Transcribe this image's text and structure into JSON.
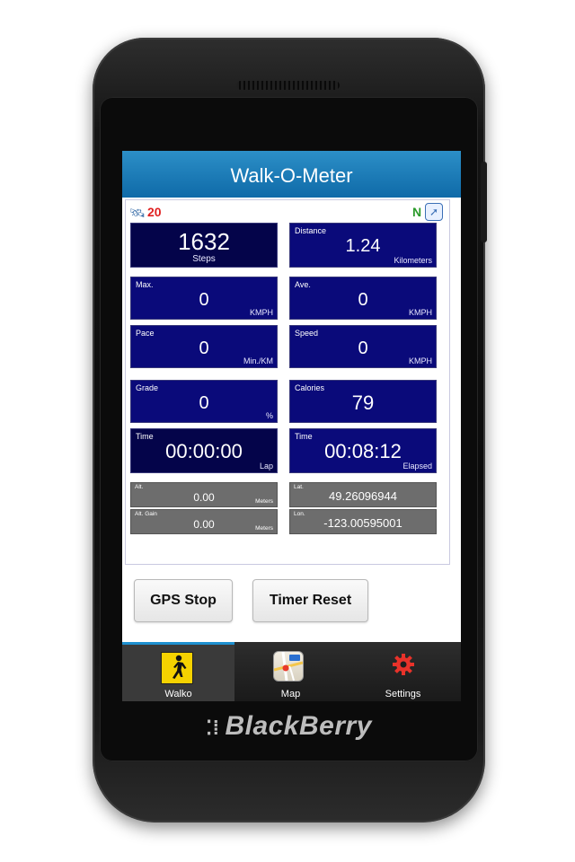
{
  "device": {
    "brand": "BlackBerry"
  },
  "app": {
    "title": "Walk-O-Meter"
  },
  "status": {
    "satellites": "20",
    "compass_heading": "N"
  },
  "tiles": {
    "steps": {
      "value": "1632",
      "unit": "Steps"
    },
    "distance": {
      "label": "Distance",
      "value": "1.24",
      "unit": "Kilometers"
    },
    "max": {
      "label": "Max.",
      "value": "0",
      "unit": "KMPH"
    },
    "ave": {
      "label": "Ave.",
      "value": "0",
      "unit": "KMPH"
    },
    "pace": {
      "label": "Pace",
      "value": "0",
      "unit": "Min./KM"
    },
    "speed": {
      "label": "Speed",
      "value": "0",
      "unit": "KMPH"
    },
    "grade": {
      "label": "Grade",
      "value": "0",
      "unit": "%"
    },
    "calories": {
      "label": "Calories",
      "value": "79"
    },
    "lap_time": {
      "label": "Time",
      "value": "00:00:00",
      "unit": "Lap"
    },
    "elapsed_time": {
      "label": "Time",
      "value": "00:08:12",
      "unit": "Elapsed"
    }
  },
  "gps": {
    "alt": {
      "label": "Alt.",
      "value": "0.00",
      "unit": "Meters"
    },
    "alt_gain": {
      "label": "Alt. Gain",
      "value": "0.00",
      "unit": "Meters"
    },
    "lat": {
      "label": "Lat.",
      "value": "49.26096944"
    },
    "lon": {
      "label": "Lon.",
      "value": "-123.00595001"
    }
  },
  "buttons": {
    "gps_stop": "GPS Stop",
    "timer_reset": "Timer Reset"
  },
  "tabs": [
    {
      "label": "Walko",
      "icon": "walking-person-icon",
      "active": true
    },
    {
      "label": "Map",
      "icon": "map-icon",
      "active": false
    },
    {
      "label": "Settings",
      "icon": "gear-icon",
      "active": false
    }
  ],
  "colors": {
    "tile_blue": "#0a0a7a",
    "title_blue": "#1a7bb8",
    "tab_accent": "#1e90d0",
    "settings_red": "#e8322a"
  }
}
